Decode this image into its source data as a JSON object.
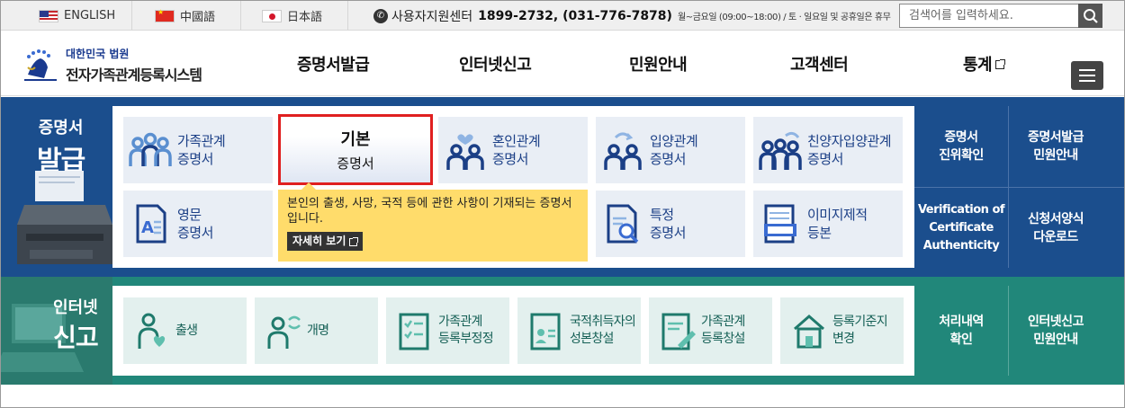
{
  "topbar": {
    "languages": [
      "ENGLISH",
      "中國語",
      "日本語"
    ],
    "support_label": "사용자지원센터",
    "support_numbers": "1899-2732, (031-776-7878)",
    "support_hours": "월~금요일 (09:00~18:00) / 토 · 일요일 및 공휴일은 휴무",
    "search_placeholder": "검색어를 입력하세요."
  },
  "header": {
    "logo_line1": "대한민국 법원",
    "logo_line2": "전자가족관계등록시스템",
    "nav": [
      "증명서발급",
      "인터넷신고",
      "민원안내",
      "고객센터",
      "통계"
    ]
  },
  "certificates": {
    "title_line1": "증명서",
    "title_line2": "발급",
    "cards": [
      {
        "line1": "가족관계",
        "line2": "증명서"
      },
      {
        "line1": "기본",
        "line2": "증명서"
      },
      {
        "line1": "혼인관계",
        "line2": "증명서"
      },
      {
        "line1": "입양관계",
        "line2": "증명서"
      },
      {
        "line1": "친양자입양관계",
        "line2": "증명서"
      },
      {
        "line1": "영문",
        "line2": "증명서"
      },
      {
        "line1": "특정",
        "line2": "증명서"
      },
      {
        "line1": "이미지제적",
        "line2": "등본"
      }
    ],
    "tooltip_text": "본인의 출생, 사망, 국적 등에 관한 사항이 기재되는 증명서입니다.",
    "tooltip_more": "자세히 보기",
    "side_links": [
      {
        "line1": "증명서",
        "line2": "진위확인"
      },
      {
        "line1": "증명서발급",
        "line2": "민원안내"
      },
      {
        "line1": "Verification of",
        "line2": "Certificate",
        "line3": "Authenticity"
      },
      {
        "line1": "신청서양식",
        "line2": "다운로드"
      }
    ]
  },
  "reports": {
    "title_line1": "인터넷",
    "title_line2": "신고",
    "cards": [
      {
        "line1": "출생",
        "line2": ""
      },
      {
        "line1": "개명",
        "line2": ""
      },
      {
        "line1": "가족관계",
        "line2": "등록부정정"
      },
      {
        "line1": "국적취득자의",
        "line2": "성본창설"
      },
      {
        "line1": "가족관계",
        "line2": "등록창설"
      },
      {
        "line1": "등록기준지",
        "line2": "변경"
      }
    ],
    "side_links": [
      {
        "line1": "처리내역",
        "line2": "확인"
      },
      {
        "line1": "인터넷신고",
        "line2": "민원안내"
      }
    ]
  },
  "colors": {
    "cert_bg": "#1b4e8d",
    "report_bg": "#21877a",
    "selected_border": "#e02020",
    "tooltip_bg": "#ffdc6b"
  }
}
